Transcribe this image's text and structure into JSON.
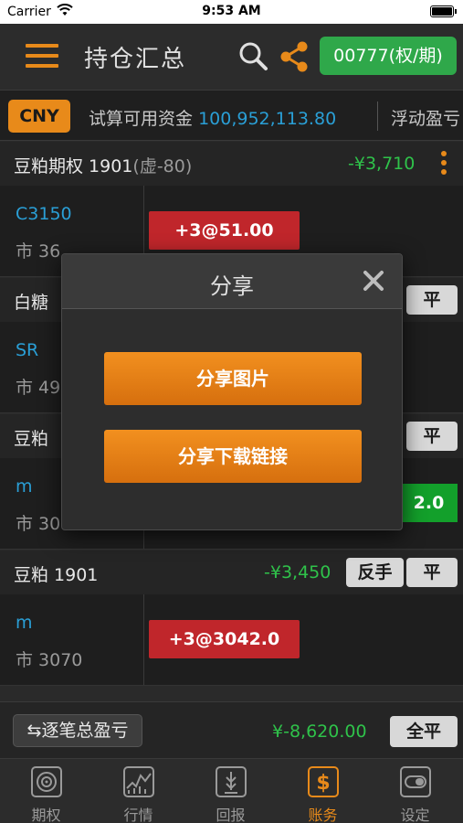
{
  "status_bar": {
    "carrier": "Carrier",
    "time": "9:53 AM"
  },
  "nav": {
    "title": "持仓汇总",
    "account": "00777(权/期)"
  },
  "info": {
    "currency": "CNY",
    "available_label": "试算可用资金",
    "available_value": "100,952,113.80",
    "floating_label": "浮动盈亏"
  },
  "groups": [
    {
      "name": "豆粕期权 1901",
      "sub": "(虚-80)",
      "pnl": "-¥3,710",
      "rows": [
        {
          "code": "C3150",
          "market": "市 36",
          "chip": "+3@51.00"
        }
      ]
    },
    {
      "name": "白糖",
      "flat": "平",
      "rows": [
        {
          "code": "SR",
          "market": "市 49"
        }
      ]
    },
    {
      "name": "豆粕",
      "flat": "平",
      "rows": [
        {
          "code": "m",
          "market": "市 30",
          "chip": "2.0"
        }
      ]
    },
    {
      "name": "豆粕 1901",
      "pnl": "-¥3,450",
      "reverse": "反手",
      "flat": "平",
      "rows": [
        {
          "code": "m",
          "market": "市 3070",
          "chip": "+3@3042.0"
        }
      ]
    }
  ],
  "summary": {
    "total_label": "逐笔总盈亏",
    "total_value": "¥-8,620.00",
    "all_flat": "全平"
  },
  "tabs": [
    {
      "label": "期权",
      "icon": "target-icon"
    },
    {
      "label": "行情",
      "icon": "chart-icon"
    },
    {
      "label": "回报",
      "icon": "report-icon"
    },
    {
      "label": "账务",
      "icon": "dollar-icon",
      "active": true
    },
    {
      "label": "设定",
      "icon": "settings-icon"
    }
  ],
  "modal": {
    "title": "分享",
    "share_image": "分享图片",
    "share_link": "分享下载链接"
  },
  "colors": {
    "accent": "#e88a1a",
    "account_green": "#2fa84a",
    "profit_green": "#2fc24a",
    "loss_red": "#c0262b",
    "value_blue": "#2a9fd6"
  }
}
